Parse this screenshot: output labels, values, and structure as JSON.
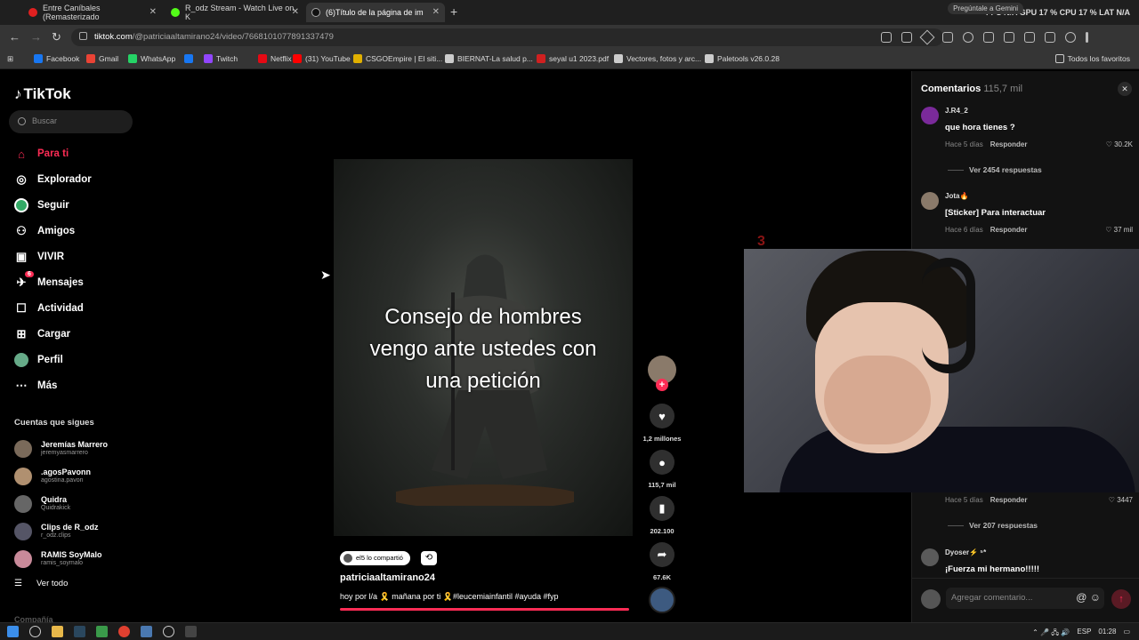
{
  "browser": {
    "tabs": [
      {
        "label": "Entre Caníbales (Remasterizado",
        "favicon_color": "#e02020"
      },
      {
        "label": "R_odz Stream - Watch Live on K",
        "favicon_color": "#53fc18"
      },
      {
        "label": "(6)Título de la página de im",
        "favicon_color": "#111111"
      }
    ],
    "new_tab": "+",
    "sys_pill": "Pregúntale a Gemini",
    "sys_stats": "FPS N/A  GPU 17 %  CPU 17 %  LAT N/A",
    "url_host": "tiktok.com",
    "url_path": "/@patriciaaltamirano24/video/7668101077891337479",
    "bookmarks": [
      {
        "label": "Facebook",
        "color": "#1877f2"
      },
      {
        "label": "Gmail",
        "color": "#ea4335"
      },
      {
        "label": "WhatsApp",
        "color": "#25d366"
      },
      {
        "label": "",
        "color": "#1877f2"
      },
      {
        "label": "Twitch",
        "color": "#9146ff"
      },
      {
        "label": "Netflix",
        "color": "#e50914"
      },
      {
        "label": "(31) YouTube",
        "color": "#ff0000"
      },
      {
        "label": "CSGOEmpire | El siti...",
        "color": "#e0b000"
      },
      {
        "label": "BIERNAT-La salud p...",
        "color": "#cccccc"
      },
      {
        "label": "seyal u1 2023.pdf",
        "color": "#d02020"
      },
      {
        "label": "Vectores, fotos y arc...",
        "color": "#cccccc"
      },
      {
        "label": "Paletools v26.0.28",
        "color": "#cccccc"
      }
    ],
    "all_favorites": "Todos los favoritos"
  },
  "tiktok": {
    "logo": "TikTok",
    "search_placeholder": "Buscar",
    "nav": [
      {
        "label": "Para ti",
        "icon": "home-icon"
      },
      {
        "label": "Explorador",
        "icon": "compass-icon"
      },
      {
        "label": "Seguir",
        "icon": "following-icon"
      },
      {
        "label": "Amigos",
        "icon": "friends-icon"
      },
      {
        "label": "VIVIR",
        "icon": "live-icon"
      },
      {
        "label": "Mensajes",
        "icon": "messages-icon",
        "badge": "6"
      },
      {
        "label": "Actividad",
        "icon": "activity-icon"
      },
      {
        "label": "Cargar",
        "icon": "upload-icon"
      },
      {
        "label": "Perfil",
        "icon": "profile-icon"
      },
      {
        "label": "Más",
        "icon": "more-icon"
      }
    ],
    "following_heading": "Cuentas que sigues",
    "accounts": [
      {
        "name": "Jeremías Marrero",
        "handle": "jeremyasmarrero"
      },
      {
        "name": ".agosPavonn",
        "handle": "agostina.pavon"
      },
      {
        "name": "Quidra",
        "handle": "Quidrakick"
      },
      {
        "name": "Clips de R_odz",
        "handle": "r_odz.clips"
      },
      {
        "name": "RAMIS SoyMalo",
        "handle": "ramis_soymalo"
      }
    ],
    "see_all": "Ver todo",
    "footer_cut": "Compañía",
    "video": {
      "caption_lines": [
        "Consejo de hombres",
        "vengo ante ustedes con",
        "una petición"
      ],
      "shared_by": "el5 lo compartió",
      "author": "patriciaaltamirano24",
      "description": "hoy por l/a 🎗️ mañana por ti 🎗️#leucemiainfantil #ayuda #fyp",
      "likes": "1,2 millones",
      "comments": "115,7 mil",
      "saves": "202.100",
      "shares": "67.6K"
    },
    "overlay_number": "3",
    "comments_panel": {
      "title": "Comentarios",
      "count": "115,7 mil",
      "reply_label": "Responder",
      "items": [
        {
          "user": "J.R4_2",
          "text": "que hora tienes ?",
          "time": "Hace 5 días",
          "likes": "30.2K",
          "replies": "Ver 2454 respuestas"
        },
        {
          "user": "Jota🔥",
          "text": "[Sticker] Para interactuar",
          "time": "Hace 6 días",
          "likes": "37 mil",
          "replies": ""
        },
        {
          "user": "",
          "text": "",
          "time": "Hace 5 días",
          "likes": "3447",
          "replies": "Ver 207 respuestas"
        },
        {
          "user": "Dyoser⚡️ ⁵*",
          "text": "¡Fuerza mi hermano!!!!!",
          "time": "",
          "likes": "",
          "replies": ""
        }
      ],
      "input_placeholder": "Agregar comentario..."
    }
  },
  "taskbar": {
    "tray_lang": "ESP",
    "tray_time": "01:28"
  }
}
